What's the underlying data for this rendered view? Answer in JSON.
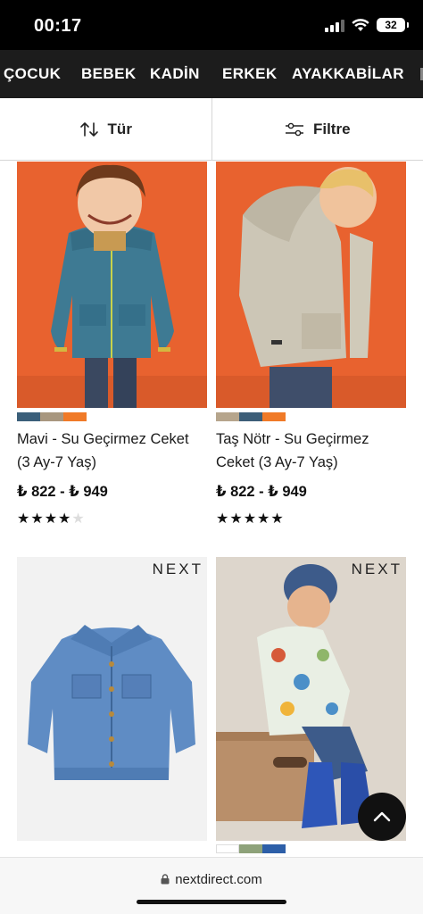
{
  "status": {
    "time": "00:17",
    "battery": "32"
  },
  "nav": {
    "items": [
      "ÇOCUK",
      "BEBEK",
      "KADİN",
      "ERKEK",
      "AYAKKABİLAR"
    ]
  },
  "toolbar": {
    "sort_label": "Tür",
    "filter_label": "Filtre"
  },
  "products": [
    {
      "title_line1": "Mavi - Su Geçirmez Ceket",
      "title_line2": "(3 Ay-7 Yaş)",
      "price": "₺ 822 - ₺ 949",
      "rating": 4,
      "swatches": [
        "#3b5f7a",
        "#a8977f",
        "#f07a28"
      ]
    },
    {
      "title_line1": "Taş Nötr - Su Geçirmez",
      "title_line2": "Ceket (3 Ay-7 Yaş)",
      "price": "₺ 822 - ₺ 949",
      "rating": 5,
      "swatches": [
        "#b6a58c",
        "#3d5e78",
        "#f07a28"
      ]
    },
    {
      "brand": "NEXT",
      "swatches": []
    },
    {
      "brand": "NEXT",
      "swatches": [
        "#ffffff",
        "#8ea27a",
        "#2d5fa8"
      ]
    }
  ],
  "url": {
    "domain": "nextdirect.com"
  },
  "colors": {
    "nav_bg": "#1c1c1c",
    "accent_orange": "#e8622f"
  }
}
